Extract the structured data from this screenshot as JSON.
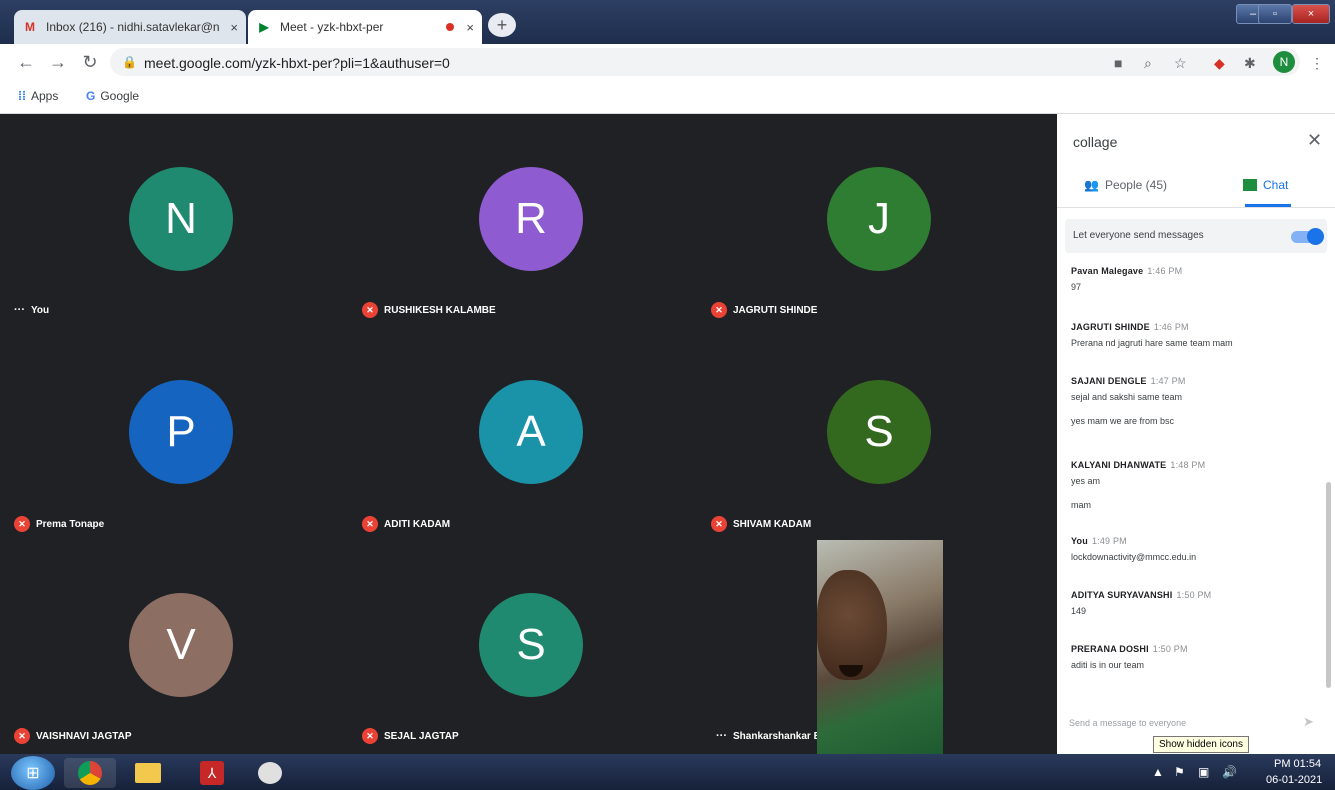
{
  "browser": {
    "tabs": [
      {
        "icon": "M",
        "title": "Inbox (216) - nidhi.satavlekar@n",
        "close": "×"
      },
      {
        "icon": "▶",
        "title": "Meet - yzk-hbxt-per",
        "close": "×"
      }
    ],
    "new_tab": "+",
    "window_controls": {
      "minimize": "–",
      "maximize": "▫",
      "close": "×"
    },
    "url": "meet.google.com/yzk-hbxt-per?pli=1&authuser=0",
    "profile_initial": "N",
    "bookmarks": [
      {
        "icon": "⁞⁞",
        "label": "Apps"
      },
      {
        "icon": "G",
        "label": "Google"
      }
    ]
  },
  "participants": [
    {
      "initial": "N",
      "name": "You",
      "color": "#1f8a70",
      "muted": false
    },
    {
      "initial": "R",
      "name": "RUSHIKESH KALAMBE",
      "color": "#8e5bd0",
      "muted": true
    },
    {
      "initial": "J",
      "name": "JAGRUTI SHINDE",
      "color": "#2e7d32",
      "muted": true
    },
    {
      "initial": "P",
      "name": "Prema Tonape",
      "color": "#1565c0",
      "muted": true
    },
    {
      "initial": "A",
      "name": "ADITI KADAM",
      "color": "#1a93a8",
      "muted": true
    },
    {
      "initial": "S",
      "name": "SHIVAM KADAM",
      "color": "#33691e",
      "muted": true
    },
    {
      "initial": "V",
      "name": "VAISHNAVI JAGTAP",
      "color": "#8d6e63",
      "muted": true
    },
    {
      "initial": "S",
      "name": "SEJAL JAGTAP",
      "color": "#1f8a70",
      "muted": true
    }
  ],
  "presenter": {
    "name": "Shankarshankar Bhoitebhoite"
  },
  "panel": {
    "title": "collage",
    "people_label": "People (45)",
    "chat_label": "Chat",
    "toggle_label": "Let everyone send messages",
    "toggle_on": true,
    "send_placeholder": "Send a message to everyone",
    "messages": [
      {
        "sender": "Pavan Malegave",
        "time": "1:46 PM",
        "lines": [
          "97"
        ]
      },
      {
        "sender": "JAGRUTI SHINDE",
        "time": "1:46 PM",
        "lines": [
          "Prerana nd jagruti hare same team mam"
        ]
      },
      {
        "sender": "SAJANI DENGLE",
        "time": "1:47 PM",
        "lines": [
          "sejal and sakshi same team",
          "yes mam we are from bsc"
        ]
      },
      {
        "sender": "KALYANI DHANWATE",
        "time": "1:48 PM",
        "lines": [
          "yes am",
          "mam"
        ]
      },
      {
        "sender": "You",
        "time": "1:49 PM",
        "lines": [
          "lockdownactivity@mmcc.edu.in"
        ]
      },
      {
        "sender": "ADITYA SURYAVANSHI",
        "time": "1:50 PM",
        "lines": [
          "149"
        ]
      },
      {
        "sender": "PRERANA DOSHI",
        "time": "1:50 PM",
        "lines": [
          "aditi is in our team"
        ]
      }
    ]
  },
  "tooltip": "Show hidden icons",
  "taskbar": {
    "clock_time": "PM 01:54",
    "clock_date": "06-01-2021"
  }
}
